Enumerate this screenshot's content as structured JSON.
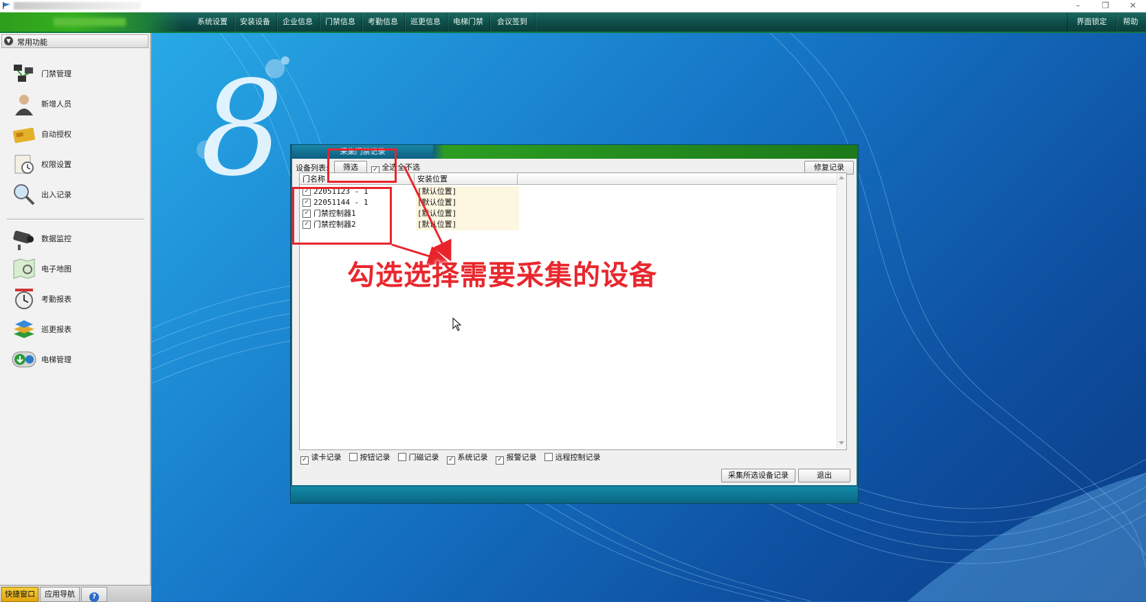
{
  "menu": [
    "系统设置",
    "安装设备",
    "企业信息",
    "门禁信息",
    "考勤信息",
    "巡更信息",
    "电梯门禁",
    "会议签到"
  ],
  "menu_right": [
    "界面锁定",
    "帮助"
  ],
  "window_controls": [
    "–",
    "❐",
    "✕"
  ],
  "sidebar": {
    "header": "常用功能",
    "items": [
      {
        "label": "门禁管理",
        "icon": "network-devices-icon"
      },
      {
        "label": "新增人员",
        "icon": "person-icon"
      },
      {
        "label": "自动授权",
        "icon": "card-icon"
      },
      {
        "label": "权限设置",
        "icon": "clock-document-icon"
      },
      {
        "label": "出入记录",
        "icon": "magnifier-icon"
      },
      {
        "label": "数据监控",
        "icon": "camera-icon"
      },
      {
        "label": "电子地图",
        "icon": "map-icon"
      },
      {
        "label": "考勤报表",
        "icon": "alarm-clock-icon"
      },
      {
        "label": "巡更报表",
        "icon": "stack-icon"
      },
      {
        "label": "电梯管理",
        "icon": "elevator-arrows-icon"
      }
    ]
  },
  "bottom_tabs": [
    "快捷窗口",
    "应用导航",
    "?"
  ],
  "dialog": {
    "tab_title": "采集门禁记录",
    "device_list_label": "设备列表:",
    "filter_button": "筛选",
    "select_all": "全选",
    "select_none": "全不选",
    "repair_button": "修复记录",
    "columns": [
      "门名称",
      "安装位置"
    ],
    "rows": [
      {
        "name": "22051123 - 1",
        "location": "[默认位置]",
        "checked": true
      },
      {
        "name": "22051144 - 1",
        "location": "[默认位置]",
        "checked": true
      },
      {
        "name": "门禁控制器1",
        "location": "[默认位置]",
        "checked": true
      },
      {
        "name": "门禁控制器2",
        "location": "[默认位置]",
        "checked": true
      }
    ],
    "options": [
      {
        "label": "读卡记录",
        "checked": true
      },
      {
        "label": "按钮记录",
        "checked": false
      },
      {
        "label": "门磁记录",
        "checked": false
      },
      {
        "label": "系统记录",
        "checked": true
      },
      {
        "label": "报警记录",
        "checked": true
      },
      {
        "label": "远程控制记录",
        "checked": false
      }
    ],
    "collect_button": "采集所选设备记录",
    "exit_button": "退出"
  },
  "annotation": "勾选选择需要采集的设备",
  "colors": {
    "annotation_red": "#e8232b",
    "menubar": "#0e4d48",
    "accent_green": "#2c9d22"
  }
}
